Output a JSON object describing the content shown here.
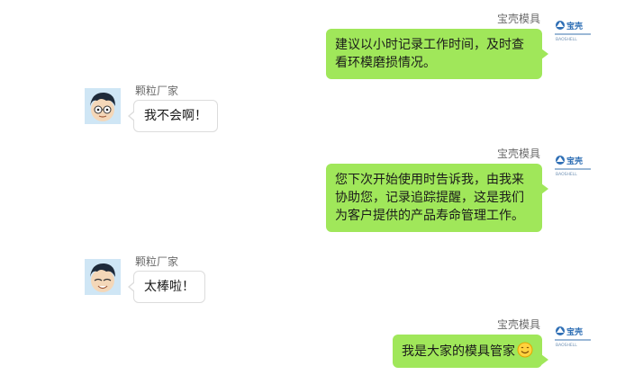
{
  "colors": {
    "outgoing_bubble": "#a0e75a",
    "incoming_bubble": "#ffffff",
    "name_text": "#6b6b6b"
  },
  "logo_avatar": {
    "icon": "company-logo-icon",
    "brand": "宝壳",
    "tagline": "BAOSHELL"
  },
  "messages": [
    {
      "side": "right",
      "sender": "宝壳模具",
      "text": "建议以小时记录工作时间，及时查看环模磨损情况。"
    },
    {
      "side": "left",
      "sender": "颗粒厂家",
      "text": "我不会啊！"
    },
    {
      "side": "right",
      "sender": "宝壳模具",
      "text": "您下次开始使用时告诉我，由我来协助您，记录追踪提醒，这是我们为客户提供的产品寿命管理工作。"
    },
    {
      "side": "left",
      "sender": "颗粒厂家",
      "text": "太棒啦！"
    },
    {
      "side": "right",
      "sender": "宝壳模具",
      "text": "我是大家的模具管家",
      "emoji": "smile-emoji-icon"
    }
  ]
}
